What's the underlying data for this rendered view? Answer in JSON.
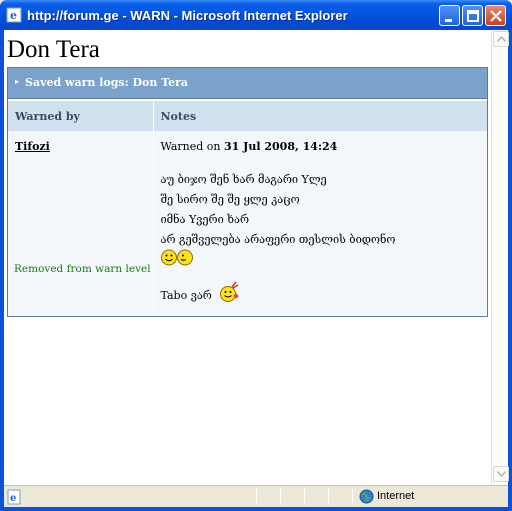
{
  "window": {
    "title": "http://forum.ge - WARN - Microsoft Internet Explorer"
  },
  "page": {
    "title": "Don Tera",
    "panel_title": "Saved warn logs: Don Tera",
    "table": {
      "headers": [
        "Warned by",
        "Notes"
      ],
      "rows": [
        {
          "warned_by": "Tifozi",
          "status": "Removed from warn level",
          "warned_on_label": "Warned on",
          "warned_on_date": "31 Jul 2008, 14:24",
          "notes_lines": [
            "აუ ბიჯო შენ ხარ მაგარი Yლე",
            "შე სირო შე შე ყლე კაცო",
            "იმნა Yვერი ხარ",
            "არ გეშველება არაფერი თესლის ბიდონო"
          ],
          "signoff": "Tabo ვარ"
        }
      ]
    }
  },
  "statusbar": {
    "zone": "Internet"
  },
  "colors": {
    "titlebar": "#0a52d6",
    "panel_header": "#7aa2ca",
    "table_header": "#d1dfee",
    "removed_text": "#1e7a1e"
  }
}
